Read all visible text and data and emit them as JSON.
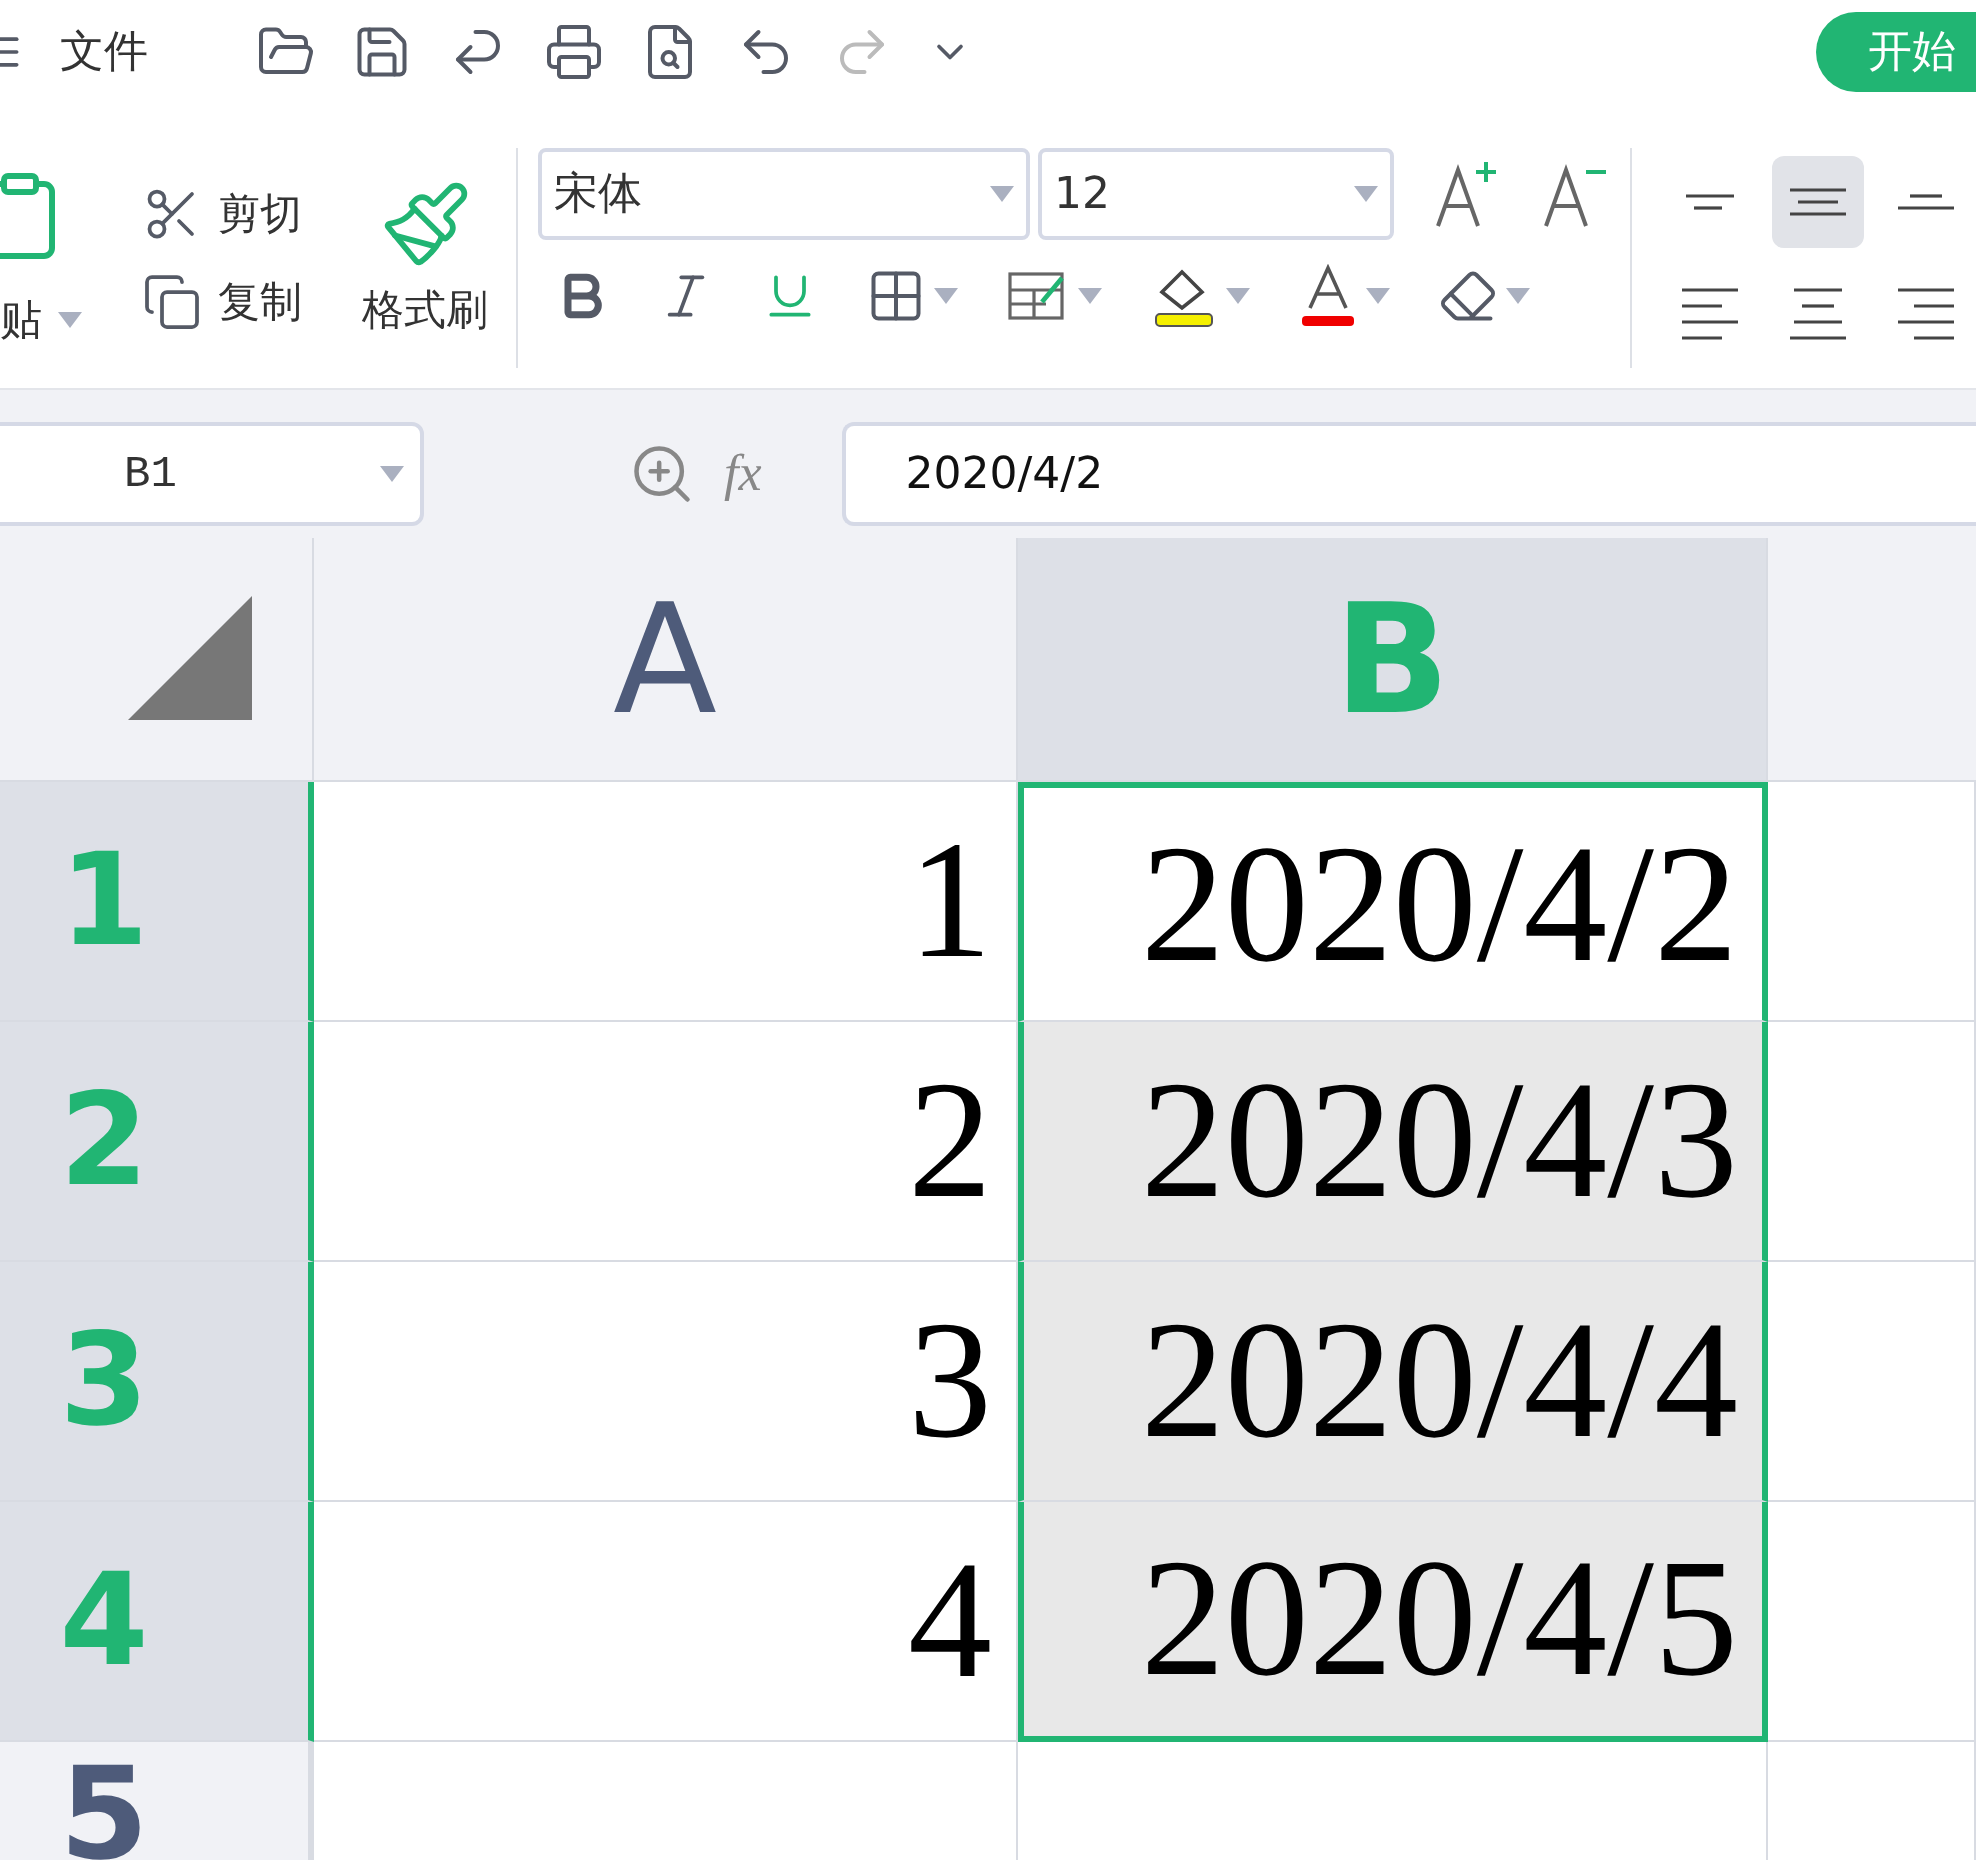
{
  "top_bar": {
    "menu_label": "文件",
    "start_tab": {
      "label": "开始",
      "selected": true
    }
  },
  "ribbon": {
    "paste_label": "贴",
    "cut_label": "剪切",
    "copy_label": "复制",
    "format_painter_label": "格式刷",
    "font_name": "宋体",
    "font_size": "12",
    "align_buttons": [
      {
        "kind": "top",
        "selected": false
      },
      {
        "kind": "middle",
        "selected": true
      },
      {
        "kind": "bottom",
        "selected": false
      },
      {
        "kind": "left",
        "selected": false
      },
      {
        "kind": "center",
        "selected": false
      },
      {
        "kind": "right",
        "selected": false
      }
    ]
  },
  "name_box": "B1",
  "formula_icon": "fx",
  "formula": "2020/4/2",
  "columns": [
    {
      "label": "A",
      "selected": false
    },
    {
      "label": "B",
      "selected": true
    }
  ],
  "rows": [
    {
      "label": "1",
      "selected": true,
      "cells": [
        {
          "value": "1",
          "selected": false,
          "active": false
        },
        {
          "value": "2020/4/2",
          "selected": true,
          "active": true
        }
      ]
    },
    {
      "label": "2",
      "selected": true,
      "cells": [
        {
          "value": "2",
          "selected": false,
          "active": false
        },
        {
          "value": "2020/4/3",
          "selected": true,
          "active": false
        }
      ]
    },
    {
      "label": "3",
      "selected": true,
      "cells": [
        {
          "value": "3",
          "selected": false,
          "active": false
        },
        {
          "value": "2020/4/4",
          "selected": true,
          "active": false
        }
      ]
    },
    {
      "label": "4",
      "selected": true,
      "cells": [
        {
          "value": "4",
          "selected": false,
          "active": false
        },
        {
          "value": "2020/4/5",
          "selected": true,
          "active": false
        }
      ]
    },
    {
      "label": "5",
      "selected": false
    }
  ]
}
